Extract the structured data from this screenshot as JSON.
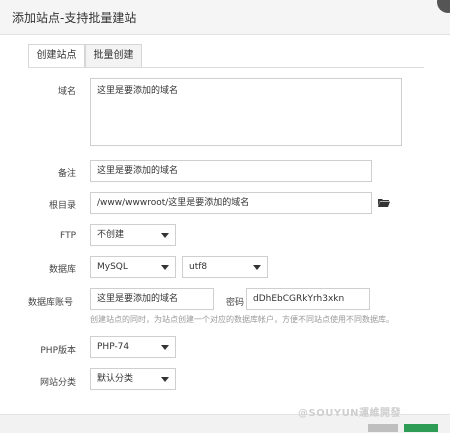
{
  "dialog": {
    "title": "添加站点-支持批量建站"
  },
  "tabs": [
    {
      "label": "创建站点"
    },
    {
      "label": "批量创建"
    }
  ],
  "form": {
    "domain": {
      "label": "域名",
      "value": "这里是要添加的域名"
    },
    "remark": {
      "label": "备注",
      "value": "这里是要添加的域名"
    },
    "rootdir": {
      "label": "根目录",
      "value": "/www/wwwroot/这里是要添加的域名"
    },
    "ftp": {
      "label": "FTP",
      "value": "不创建"
    },
    "database": {
      "label": "数据库",
      "type": "MySQL",
      "charset": "utf8"
    },
    "db_account": {
      "label": "数据库账号",
      "value": "这里是要添加的域名",
      "password_label": "密码",
      "password": "dDhEbCGRkYrh3xkn"
    },
    "db_hint": "创建站点的同时，为站点创建一个对应的数据库帐户，方便不同站点使用不同数据库。",
    "php": {
      "label": "PHP版本",
      "value": "PHP-74"
    },
    "category": {
      "label": "网站分类",
      "value": "默认分类"
    }
  },
  "watermark": "@SOUYUN運維開發",
  "colors": {
    "ok": "#2e9c54",
    "folder": "#333333"
  }
}
